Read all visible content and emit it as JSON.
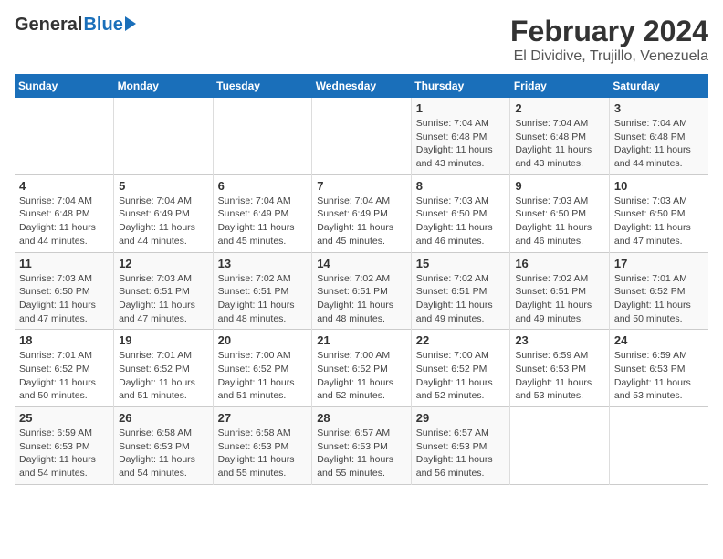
{
  "header": {
    "logo_general": "General",
    "logo_blue": "Blue",
    "month_title": "February 2024",
    "location": "El Dividive, Trujillo, Venezuela"
  },
  "weekdays": [
    "Sunday",
    "Monday",
    "Tuesday",
    "Wednesday",
    "Thursday",
    "Friday",
    "Saturday"
  ],
  "weeks": [
    [
      {
        "day": "",
        "info": ""
      },
      {
        "day": "",
        "info": ""
      },
      {
        "day": "",
        "info": ""
      },
      {
        "day": "",
        "info": ""
      },
      {
        "day": "1",
        "info": "Sunrise: 7:04 AM\nSunset: 6:48 PM\nDaylight: 11 hours and 43 minutes."
      },
      {
        "day": "2",
        "info": "Sunrise: 7:04 AM\nSunset: 6:48 PM\nDaylight: 11 hours and 43 minutes."
      },
      {
        "day": "3",
        "info": "Sunrise: 7:04 AM\nSunset: 6:48 PM\nDaylight: 11 hours and 44 minutes."
      }
    ],
    [
      {
        "day": "4",
        "info": "Sunrise: 7:04 AM\nSunset: 6:48 PM\nDaylight: 11 hours and 44 minutes."
      },
      {
        "day": "5",
        "info": "Sunrise: 7:04 AM\nSunset: 6:49 PM\nDaylight: 11 hours and 44 minutes."
      },
      {
        "day": "6",
        "info": "Sunrise: 7:04 AM\nSunset: 6:49 PM\nDaylight: 11 hours and 45 minutes."
      },
      {
        "day": "7",
        "info": "Sunrise: 7:04 AM\nSunset: 6:49 PM\nDaylight: 11 hours and 45 minutes."
      },
      {
        "day": "8",
        "info": "Sunrise: 7:03 AM\nSunset: 6:50 PM\nDaylight: 11 hours and 46 minutes."
      },
      {
        "day": "9",
        "info": "Sunrise: 7:03 AM\nSunset: 6:50 PM\nDaylight: 11 hours and 46 minutes."
      },
      {
        "day": "10",
        "info": "Sunrise: 7:03 AM\nSunset: 6:50 PM\nDaylight: 11 hours and 47 minutes."
      }
    ],
    [
      {
        "day": "11",
        "info": "Sunrise: 7:03 AM\nSunset: 6:50 PM\nDaylight: 11 hours and 47 minutes."
      },
      {
        "day": "12",
        "info": "Sunrise: 7:03 AM\nSunset: 6:51 PM\nDaylight: 11 hours and 47 minutes."
      },
      {
        "day": "13",
        "info": "Sunrise: 7:02 AM\nSunset: 6:51 PM\nDaylight: 11 hours and 48 minutes."
      },
      {
        "day": "14",
        "info": "Sunrise: 7:02 AM\nSunset: 6:51 PM\nDaylight: 11 hours and 48 minutes."
      },
      {
        "day": "15",
        "info": "Sunrise: 7:02 AM\nSunset: 6:51 PM\nDaylight: 11 hours and 49 minutes."
      },
      {
        "day": "16",
        "info": "Sunrise: 7:02 AM\nSunset: 6:51 PM\nDaylight: 11 hours and 49 minutes."
      },
      {
        "day": "17",
        "info": "Sunrise: 7:01 AM\nSunset: 6:52 PM\nDaylight: 11 hours and 50 minutes."
      }
    ],
    [
      {
        "day": "18",
        "info": "Sunrise: 7:01 AM\nSunset: 6:52 PM\nDaylight: 11 hours and 50 minutes."
      },
      {
        "day": "19",
        "info": "Sunrise: 7:01 AM\nSunset: 6:52 PM\nDaylight: 11 hours and 51 minutes."
      },
      {
        "day": "20",
        "info": "Sunrise: 7:00 AM\nSunset: 6:52 PM\nDaylight: 11 hours and 51 minutes."
      },
      {
        "day": "21",
        "info": "Sunrise: 7:00 AM\nSunset: 6:52 PM\nDaylight: 11 hours and 52 minutes."
      },
      {
        "day": "22",
        "info": "Sunrise: 7:00 AM\nSunset: 6:52 PM\nDaylight: 11 hours and 52 minutes."
      },
      {
        "day": "23",
        "info": "Sunrise: 6:59 AM\nSunset: 6:53 PM\nDaylight: 11 hours and 53 minutes."
      },
      {
        "day": "24",
        "info": "Sunrise: 6:59 AM\nSunset: 6:53 PM\nDaylight: 11 hours and 53 minutes."
      }
    ],
    [
      {
        "day": "25",
        "info": "Sunrise: 6:59 AM\nSunset: 6:53 PM\nDaylight: 11 hours and 54 minutes."
      },
      {
        "day": "26",
        "info": "Sunrise: 6:58 AM\nSunset: 6:53 PM\nDaylight: 11 hours and 54 minutes."
      },
      {
        "day": "27",
        "info": "Sunrise: 6:58 AM\nSunset: 6:53 PM\nDaylight: 11 hours and 55 minutes."
      },
      {
        "day": "28",
        "info": "Sunrise: 6:57 AM\nSunset: 6:53 PM\nDaylight: 11 hours and 55 minutes."
      },
      {
        "day": "29",
        "info": "Sunrise: 6:57 AM\nSunset: 6:53 PM\nDaylight: 11 hours and 56 minutes."
      },
      {
        "day": "",
        "info": ""
      },
      {
        "day": "",
        "info": ""
      }
    ]
  ]
}
